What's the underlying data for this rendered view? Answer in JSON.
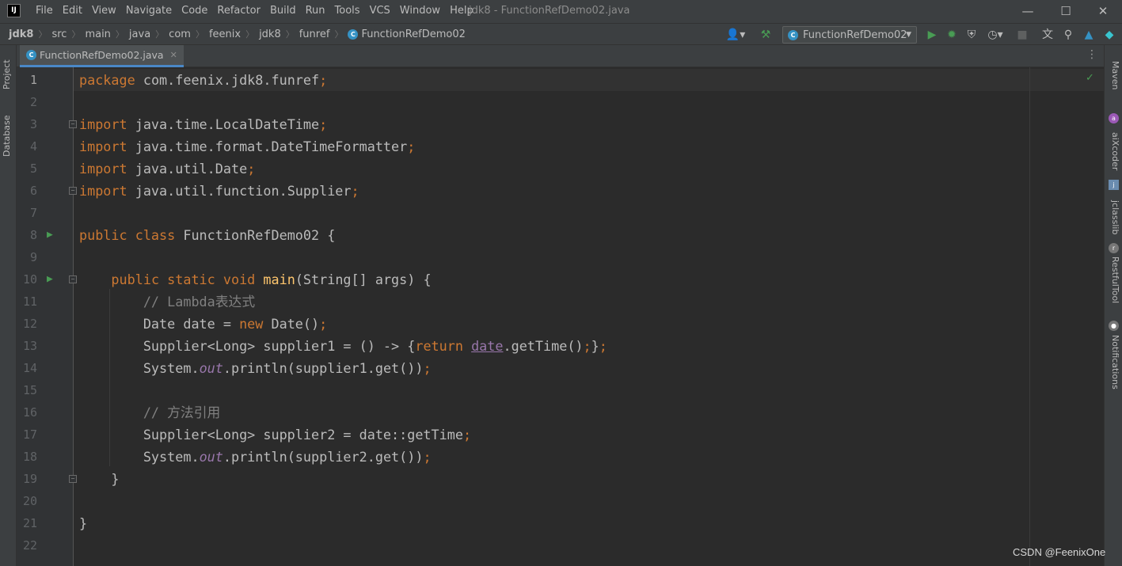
{
  "window": {
    "app_logo": "IJ",
    "menu": [
      "File",
      "Edit",
      "View",
      "Navigate",
      "Code",
      "Refactor",
      "Build",
      "Run",
      "Tools",
      "VCS",
      "Window",
      "Help"
    ],
    "title": "jdk8 - FunctionRefDemo02.java"
  },
  "navbar": {
    "breadcrumbs": [
      "jdk8",
      "src",
      "main",
      "java",
      "com",
      "feenix",
      "jdk8",
      "funref",
      "FunctionRefDemo02"
    ],
    "run_config": "FunctionRefDemo02"
  },
  "left_tools": [
    "Project",
    "Database"
  ],
  "right_tools": [
    "Maven",
    "aiXcoder",
    "jclasslib",
    "RestfulTool",
    "Notifications"
  ],
  "editor": {
    "tab_label": "FunctionRefDemo02.java",
    "current_line": 1,
    "lines": [
      {
        "n": "1",
        "code": [
          {
            "t": "package",
            "c": "kw"
          },
          {
            "t": " com.feenix.jdk8.funref",
            "c": ""
          },
          {
            "t": ";",
            "c": "kw"
          }
        ]
      },
      {
        "n": "2",
        "code": []
      },
      {
        "n": "3",
        "code": [
          {
            "t": "import",
            "c": "kw"
          },
          {
            "t": " java.time.LocalDateTime",
            "c": ""
          },
          {
            "t": ";",
            "c": "kw"
          }
        ]
      },
      {
        "n": "4",
        "code": [
          {
            "t": "import",
            "c": "kw"
          },
          {
            "t": " java.time.format.DateTimeFormatter",
            "c": ""
          },
          {
            "t": ";",
            "c": "kw"
          }
        ]
      },
      {
        "n": "5",
        "code": [
          {
            "t": "import",
            "c": "kw"
          },
          {
            "t": " java.util.Date",
            "c": ""
          },
          {
            "t": ";",
            "c": "kw"
          }
        ]
      },
      {
        "n": "6",
        "code": [
          {
            "t": "import",
            "c": "kw"
          },
          {
            "t": " java.util.function.Supplier",
            "c": ""
          },
          {
            "t": ";",
            "c": "kw"
          }
        ]
      },
      {
        "n": "7",
        "code": []
      },
      {
        "n": "8",
        "code": [
          {
            "t": "public class",
            "c": "kw"
          },
          {
            "t": " FunctionRefDemo02 {",
            "c": ""
          }
        ]
      },
      {
        "n": "9",
        "code": []
      },
      {
        "n": "10",
        "code": [
          {
            "t": "    ",
            "c": ""
          },
          {
            "t": "public static void",
            "c": "kw"
          },
          {
            "t": " ",
            "c": ""
          },
          {
            "t": "main",
            "c": "fn"
          },
          {
            "t": "(String[] args) {",
            "c": ""
          }
        ]
      },
      {
        "n": "11",
        "code": [
          {
            "t": "        // Lambda表达式",
            "c": "cm"
          }
        ]
      },
      {
        "n": "12",
        "code": [
          {
            "t": "        Date date = ",
            "c": ""
          },
          {
            "t": "new",
            "c": "kw"
          },
          {
            "t": " Date()",
            "c": ""
          },
          {
            "t": ";",
            "c": "kw"
          }
        ]
      },
      {
        "n": "13",
        "code": [
          {
            "t": "        Supplier<Long> supplier1 = () -> {",
            "c": ""
          },
          {
            "t": "return",
            "c": "kw"
          },
          {
            "t": " ",
            "c": ""
          },
          {
            "t": "date",
            "c": "pd"
          },
          {
            "t": ".getTime()",
            "c": ""
          },
          {
            "t": ";",
            "c": "kw"
          },
          {
            "t": "}",
            "c": ""
          },
          {
            "t": ";",
            "c": "kw"
          }
        ]
      },
      {
        "n": "14",
        "code": [
          {
            "t": "        System.",
            "c": ""
          },
          {
            "t": "out",
            "c": "st"
          },
          {
            "t": ".println(supplier1.get())",
            "c": ""
          },
          {
            "t": ";",
            "c": "kw"
          }
        ]
      },
      {
        "n": "15",
        "code": []
      },
      {
        "n": "16",
        "code": [
          {
            "t": "        // 方法引用",
            "c": "cm"
          }
        ]
      },
      {
        "n": "17",
        "code": [
          {
            "t": "        Supplier<Long> supplier2 = date::getTime",
            "c": ""
          },
          {
            "t": ";",
            "c": "kw"
          }
        ]
      },
      {
        "n": "18",
        "code": [
          {
            "t": "        System.",
            "c": ""
          },
          {
            "t": "out",
            "c": "st"
          },
          {
            "t": ".println(supplier2.get())",
            "c": ""
          },
          {
            "t": ";",
            "c": "kw"
          }
        ]
      },
      {
        "n": "19",
        "code": [
          {
            "t": "    }",
            "c": ""
          }
        ]
      },
      {
        "n": "20",
        "code": []
      },
      {
        "n": "21",
        "code": [
          {
            "t": "}",
            "c": ""
          }
        ]
      },
      {
        "n": "22",
        "code": []
      }
    ],
    "run_marker_lines": [
      "8",
      "10"
    ],
    "fold_marker_lines": [
      "3",
      "6",
      "10",
      "19"
    ]
  },
  "watermark": "CSDN @FeenixOne",
  "colors": {
    "keyword": "#cc7832",
    "method": "#ffc66d",
    "comment": "#808080",
    "static_field": "#9876aa",
    "run_gutter": "#499c54",
    "background": "#2b2b2b"
  }
}
